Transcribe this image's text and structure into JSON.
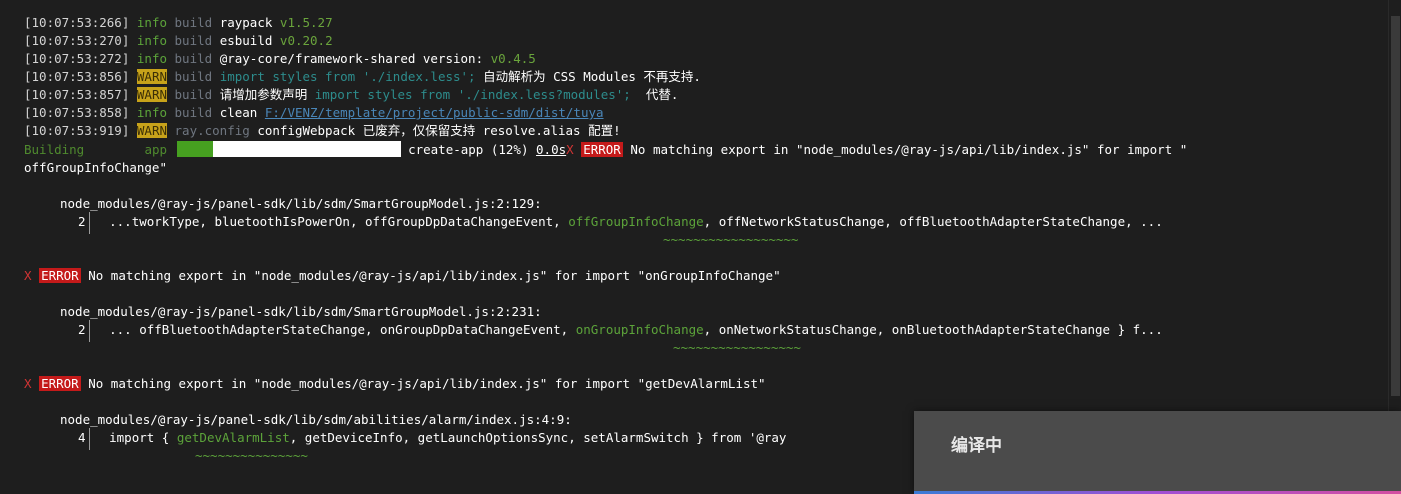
{
  "log": [
    {
      "ts": "[10:07:53:266]",
      "level": "info",
      "module": "build",
      "pkg": "raypack",
      "ver": "v1.5.27"
    },
    {
      "ts": "[10:07:53:270]",
      "level": "info",
      "module": "build",
      "pkg": "esbuild",
      "ver": "v0.20.2"
    },
    {
      "ts": "[10:07:53:272]",
      "level": "info",
      "module": "build",
      "pkg": "@ray-core/framework-shared version:",
      "ver": "v0.4.5"
    },
    {
      "ts": "[10:07:53:856]",
      "level": "WARN",
      "module": "build",
      "code": "import styles from './index.less';",
      "msg": " 自动解析为 CSS Modules 不再支持."
    },
    {
      "ts": "[10:07:53:857]",
      "level": "WARN",
      "module": "build",
      "pre": "请增加参数声明 ",
      "code": "import styles from './index.less?modules';",
      "msg": "  代替."
    },
    {
      "ts": "[10:07:53:858]",
      "level": "info",
      "module": "build",
      "pkg": "clean",
      "path": "F:/VENZ/template/project/public-sdm/dist/tuya"
    },
    {
      "ts": "[10:07:53:919]",
      "level": "WARN",
      "module": "ray.config",
      "pkg": "configWebpack",
      "msg": " 已废弃，仅保留支持 resolve.alias 配置!"
    }
  ],
  "building": {
    "label": "Building",
    "target": "app",
    "task": "create-app (12%)",
    "time": "0.0s"
  },
  "errors": [
    {
      "symbol": "X",
      "badge": "ERROR",
      "message": "No matching export in \"node_modules/@ray-js/api/lib/index.js\" for import \"",
      "message_cont": "offGroupInfoChange\"",
      "location": "node_modules/@ray-js/panel-sdk/lib/sdm/SmartGroupModel.js:2:129:",
      "line_no": "2",
      "pre": "...tworkType, bluetoothIsPowerOn, offGroupDpDataChangeEvent, ",
      "hl": "offGroupInfoChange",
      "post": ", offNetworkStatusChange, offBluetoothAdapterStateChange, ...",
      "squiggle": "~~~~~~~~~~~~~~~~~~"
    },
    {
      "symbol": "X",
      "badge": "ERROR",
      "message": "No matching export in \"node_modules/@ray-js/api/lib/index.js\" for import \"onGroupInfoChange\"",
      "location": "node_modules/@ray-js/panel-sdk/lib/sdm/SmartGroupModel.js:2:231:",
      "line_no": "2",
      "pre": "... offBluetoothAdapterStateChange, onGroupDpDataChangeEvent, ",
      "hl": "onGroupInfoChange",
      "post": ", onNetworkStatusChange, onBluetoothAdapterStateChange } f...",
      "squiggle": "~~~~~~~~~~~~~~~~~"
    },
    {
      "symbol": "X",
      "badge": "ERROR",
      "message": "No matching export in \"node_modules/@ray-js/api/lib/index.js\" for import \"getDevAlarmList\"",
      "location": "node_modules/@ray-js/panel-sdk/lib/sdm/abilities/alarm/index.js:4:9:",
      "line_no": "4",
      "pre": "import { ",
      "hl": "getDevAlarmList",
      "post": ", getDeviceInfo, getLaunchOptionsSync, setAlarmSwitch } from '@ray",
      "squiggle": "~~~~~~~~~~~~~~~"
    }
  ],
  "toast": {
    "title": "编译中"
  }
}
